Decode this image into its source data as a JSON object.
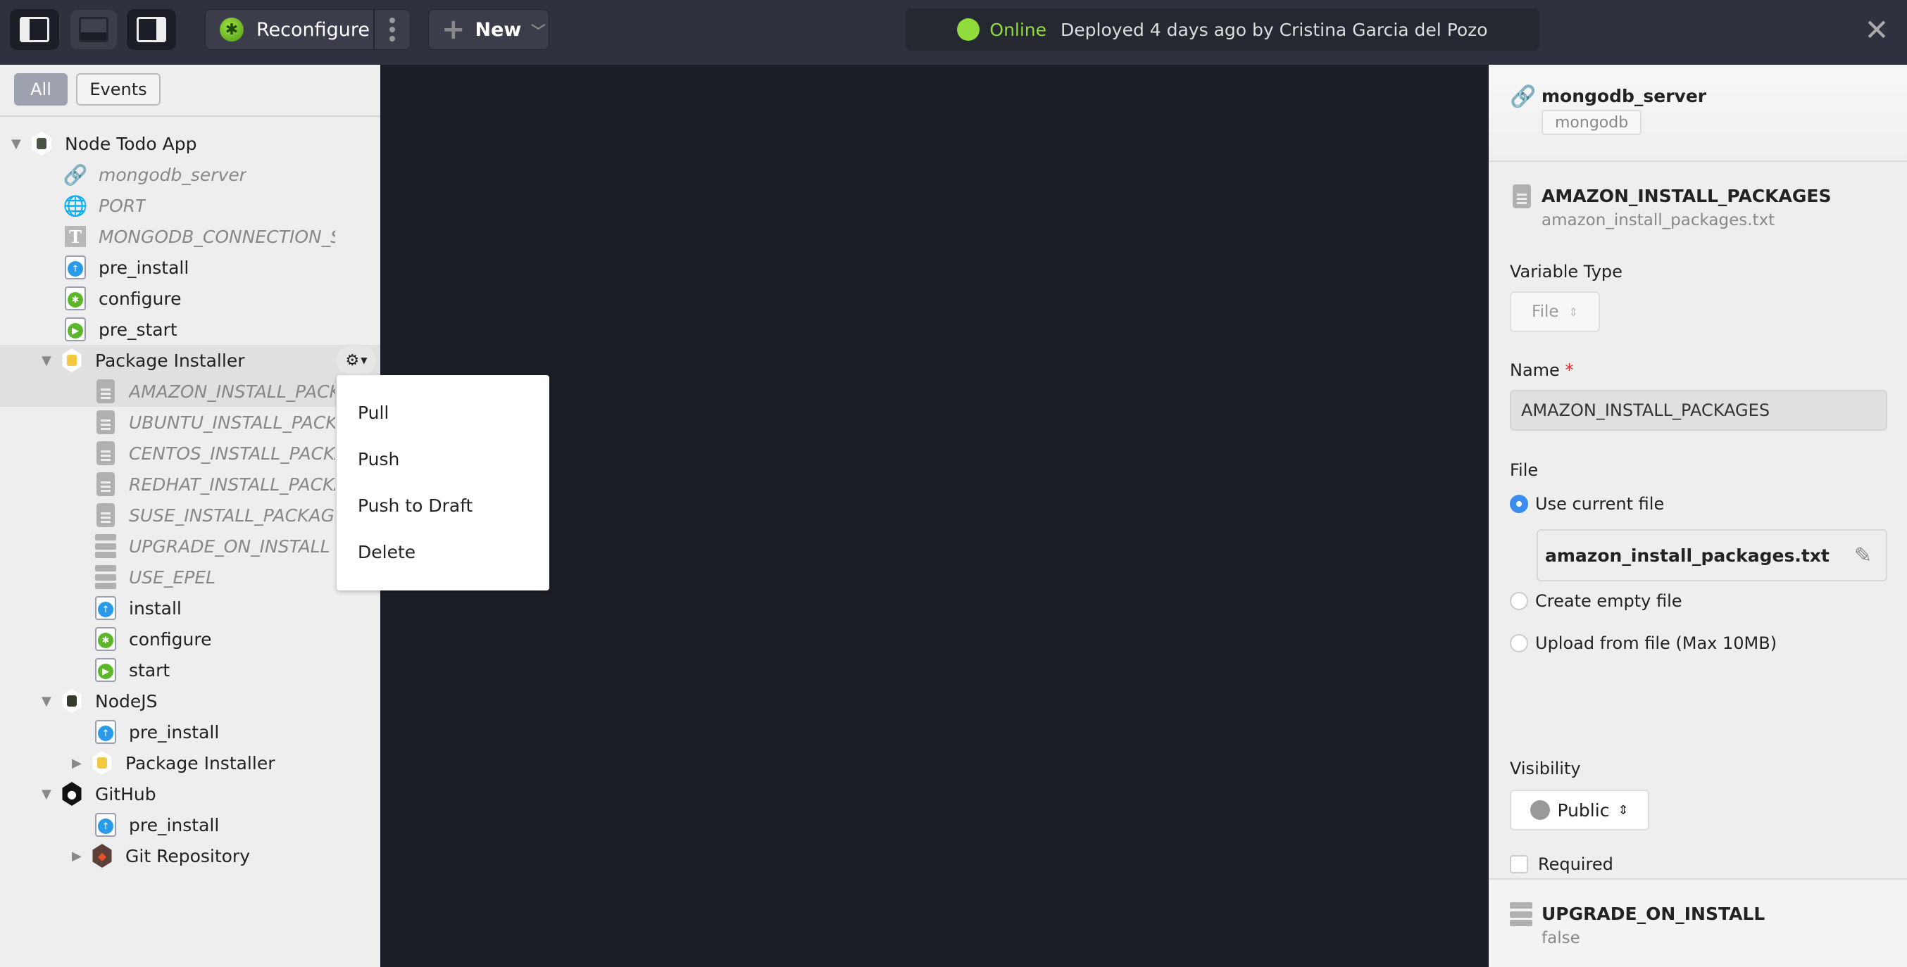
{
  "toolbar": {
    "layout_buttons": [
      {
        "name": "left-panel-toggle",
        "active": true
      },
      {
        "name": "bottom-panel-toggle",
        "active": false
      },
      {
        "name": "right-panel-toggle",
        "active": true
      }
    ],
    "reconfigure_label": "Reconfigure",
    "new_label": "New",
    "status": {
      "state": "Online",
      "message": "Deployed 4 days ago by Cristina Garcia del Pozo",
      "color": "#8fdc3c"
    },
    "close_icon": "close-icon"
  },
  "left_panel": {
    "filters": [
      {
        "label": "All",
        "active": true
      },
      {
        "label": "Events",
        "active": false
      }
    ],
    "tree": [
      {
        "label": "Node Todo App",
        "level": 0,
        "type": "blueprint",
        "expanded": true,
        "italic": false
      },
      {
        "label": "mongodb_server",
        "level": 1,
        "type": "link",
        "italic": true
      },
      {
        "label": "PORT",
        "level": 1,
        "type": "port",
        "italic": true
      },
      {
        "label": "MONGODB_CONNECTION_STRING",
        "level": 1,
        "type": "text-var",
        "italic": true
      },
      {
        "label": "pre_install",
        "level": 1,
        "type": "script-install",
        "italic": false
      },
      {
        "label": "configure",
        "level": 1,
        "type": "script-configure",
        "italic": false
      },
      {
        "label": "pre_start",
        "level": 1,
        "type": "script-start",
        "italic": false
      },
      {
        "label": "Package Installer",
        "level": 1,
        "type": "service-package",
        "expanded": true,
        "italic": false,
        "selected": true
      },
      {
        "label": "AMAZON_INSTALL_PACKAGES",
        "level": 2,
        "type": "file-var",
        "italic": true,
        "selected": true
      },
      {
        "label": "UBUNTU_INSTALL_PACKAGES",
        "level": 2,
        "type": "file-var",
        "italic": true
      },
      {
        "label": "CENTOS_INSTALL_PACKAGES",
        "level": 2,
        "type": "file-var",
        "italic": true
      },
      {
        "label": "REDHAT_INSTALL_PACKAGES",
        "level": 2,
        "type": "file-var",
        "italic": true
      },
      {
        "label": "SUSE_INSTALL_PACKAGES",
        "level": 2,
        "type": "file-var",
        "italic": true
      },
      {
        "label": "UPGRADE_ON_INSTALL",
        "level": 2,
        "type": "bool-var",
        "italic": true
      },
      {
        "label": "USE_EPEL",
        "level": 2,
        "type": "bool-var",
        "italic": true
      },
      {
        "label": "install",
        "level": 2,
        "type": "script-install",
        "italic": false
      },
      {
        "label": "configure",
        "level": 2,
        "type": "script-configure",
        "italic": false
      },
      {
        "label": "start",
        "level": 2,
        "type": "script-start",
        "italic": false
      },
      {
        "label": "NodeJS",
        "level": 1,
        "type": "service-node",
        "expanded": true,
        "italic": false
      },
      {
        "label": "pre_install",
        "level": 2,
        "type": "script-install",
        "italic": false
      },
      {
        "label": "Package Installer",
        "level": 2,
        "type": "service-package",
        "expanded": false,
        "italic": false
      },
      {
        "label": "GitHub",
        "level": 1,
        "type": "service-github",
        "expanded": true,
        "italic": false
      },
      {
        "label": "pre_install",
        "level": 2,
        "type": "script-install",
        "italic": false
      },
      {
        "label": "Git Repository",
        "level": 2,
        "type": "service-git",
        "expanded": false,
        "italic": false
      }
    ],
    "context_menu": {
      "items": [
        "Pull",
        "Push",
        "Push to Draft",
        "Delete"
      ]
    }
  },
  "right_panel": {
    "header": {
      "title": "mongodb_server",
      "tag": "mongodb"
    },
    "variable": {
      "title": "AMAZON_INSTALL_PACKAGES",
      "subtitle": "amazon_install_packages.txt"
    },
    "variable_type_label": "Variable Type",
    "variable_type_value": "File",
    "name_label": "Name",
    "name_required_mark": "*",
    "name_value": "AMAZON_INSTALL_PACKAGES",
    "file_label": "File",
    "file_options": [
      {
        "label": "Use current file",
        "checked": true
      },
      {
        "label": "Create empty file",
        "checked": false
      },
      {
        "label": "Upload from file (Max 10MB)",
        "checked": false
      }
    ],
    "current_file": "amazon_install_packages.txt",
    "visibility_label": "Visibility",
    "visibility_value": "Public",
    "required_label": "Required",
    "required_checked": false,
    "footer": {
      "title": "UPGRADE_ON_INSTALL",
      "value": "false"
    }
  }
}
